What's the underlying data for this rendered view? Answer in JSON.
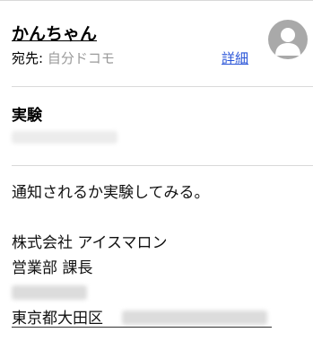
{
  "message": {
    "sender_name": "かんちゃん",
    "to_label": "宛先:",
    "to_value": "自分ドコモ",
    "details_label": "詳細",
    "subject": "実験",
    "body_lines": [
      "通知されるか実験してみる。",
      "株式会社 アイスマロン",
      "営業部 課長",
      "東京都大田区"
    ]
  },
  "icons": {
    "avatar": "person-silhouette-icon"
  }
}
